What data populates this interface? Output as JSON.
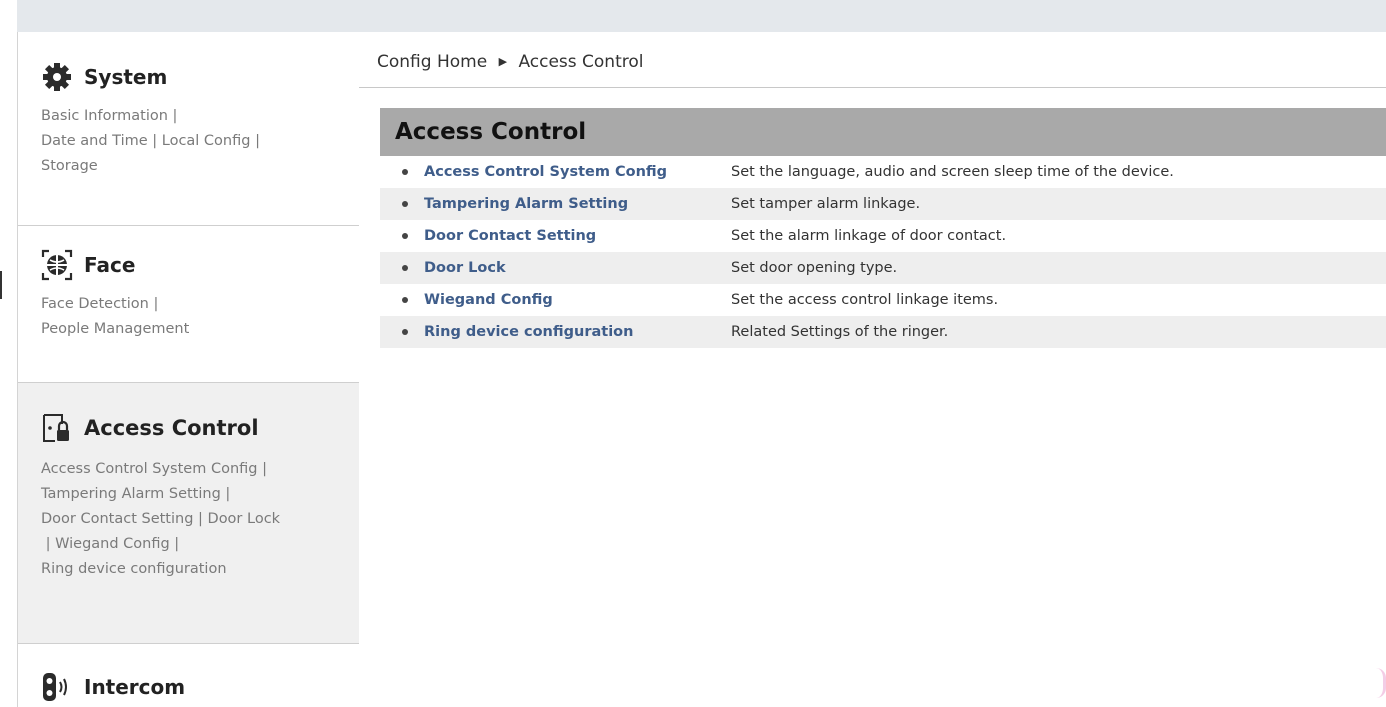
{
  "sidebar": {
    "system": {
      "title": "System",
      "icon": "gear-icon",
      "links": [
        "Basic Information |",
        "Date and Time | Local Config |",
        "Storage"
      ]
    },
    "face": {
      "title": "Face",
      "icon": "face-scan-icon",
      "links": [
        "Face Detection |",
        "People Management"
      ]
    },
    "access": {
      "title": "Access Control",
      "icon": "door-lock-icon",
      "links": [
        "Access Control System Config |",
        "Tampering Alarm Setting |",
        "Door Contact Setting | Door Lock",
        " | Wiegand Config |",
        "Ring device configuration"
      ]
    },
    "intercom": {
      "title": "Intercom",
      "icon": "doorbell-icon"
    }
  },
  "breadcrumb": {
    "home": "Config Home",
    "separator": "▶",
    "current": "Access Control"
  },
  "panel": {
    "title": "Access Control",
    "items": [
      {
        "label": "Access Control System Config",
        "desc": "Set the language, audio and screen sleep time of the device."
      },
      {
        "label": "Tampering Alarm Setting",
        "desc": "Set tamper alarm linkage."
      },
      {
        "label": "Door Contact Setting",
        "desc": "Set the alarm linkage of door contact."
      },
      {
        "label": "Door Lock",
        "desc": "Set door opening type."
      },
      {
        "label": "Wiegand Config",
        "desc": "Set the access control linkage items."
      },
      {
        "label": "Ring device configuration",
        "desc": "Related Settings of the ringer."
      }
    ]
  },
  "colors": {
    "link": "#3f5d8a",
    "panel_header": "#a9a9a9",
    "active_section": "#f0f0f0"
  }
}
